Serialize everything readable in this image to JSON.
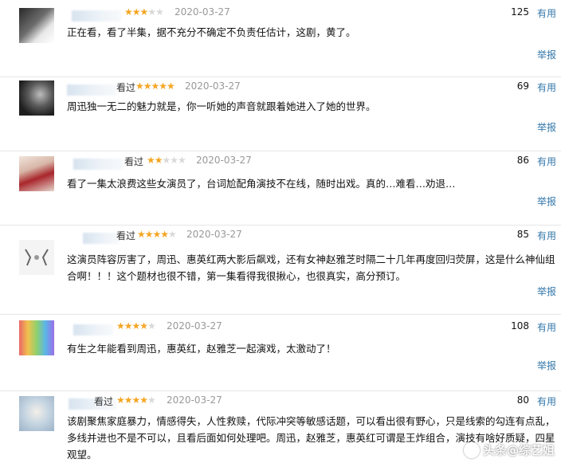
{
  "reviews": [
    {
      "watch": "",
      "stars": 3,
      "date": "2020-03-27",
      "votes": "125",
      "useful": "有用",
      "content": "正在看，看了半集，据不充分不确定不负责任估计，这剧，黄了。",
      "report": "举报"
    },
    {
      "watch": "看过",
      "stars": 5,
      "date": "2020-03-27",
      "votes": "69",
      "useful": "有用",
      "content": "周迅独一无二的魅力就是，你一听她的声音就跟着她进入了她的世界。",
      "report": "举报"
    },
    {
      "watch": "看过",
      "stars": 2,
      "date": "2020-03-27",
      "votes": "86",
      "useful": "有用",
      "content": "看了一集太浪费这些女演员了，台词尬配角演技不在线，随时出戏。真的…难看…劝退…",
      "report": "举报"
    },
    {
      "watch": "看过",
      "stars": 4,
      "date": "2020-03-27",
      "votes": "85",
      "useful": "有用",
      "content": "这演员阵容厉害了，周迅、惠英红两大影后飙戏，还有女神赵雅芝时隔二十几年再度回归荧屏，这是什么神仙组合啊！！！这个题材也很不错，第一集看得我很揪心，也很真实，高分预订。",
      "report": "举报"
    },
    {
      "watch": "",
      "stars": 4,
      "date": "2020-03-27",
      "votes": "108",
      "useful": "有用",
      "content": "有生之年能看到周迅，惠英红，赵雅芝一起演戏，太激动了！",
      "report": "举报"
    },
    {
      "watch": "看过",
      "stars": 4,
      "date": "2020-03-27",
      "votes": "80",
      "useful": "有用",
      "content": "该剧聚焦家庭暴力，情感得失，人性救赎，代际冲突等敏感话题，可以看出很有野心，只是线索的勾连有点乱，多线并进也不是不可以，且看后面如何处理吧。周迅，赵雅芝，惠英红可谓是王炸组合，演技有啥好质疑，四星观望。",
      "report": ""
    }
  ],
  "watermark": {
    "text": "头条@综艺姐"
  },
  "colors": {
    "star_on": "#f4a623",
    "star_off": "#d9d9d9",
    "link": "#3377aa",
    "date": "#999999"
  }
}
